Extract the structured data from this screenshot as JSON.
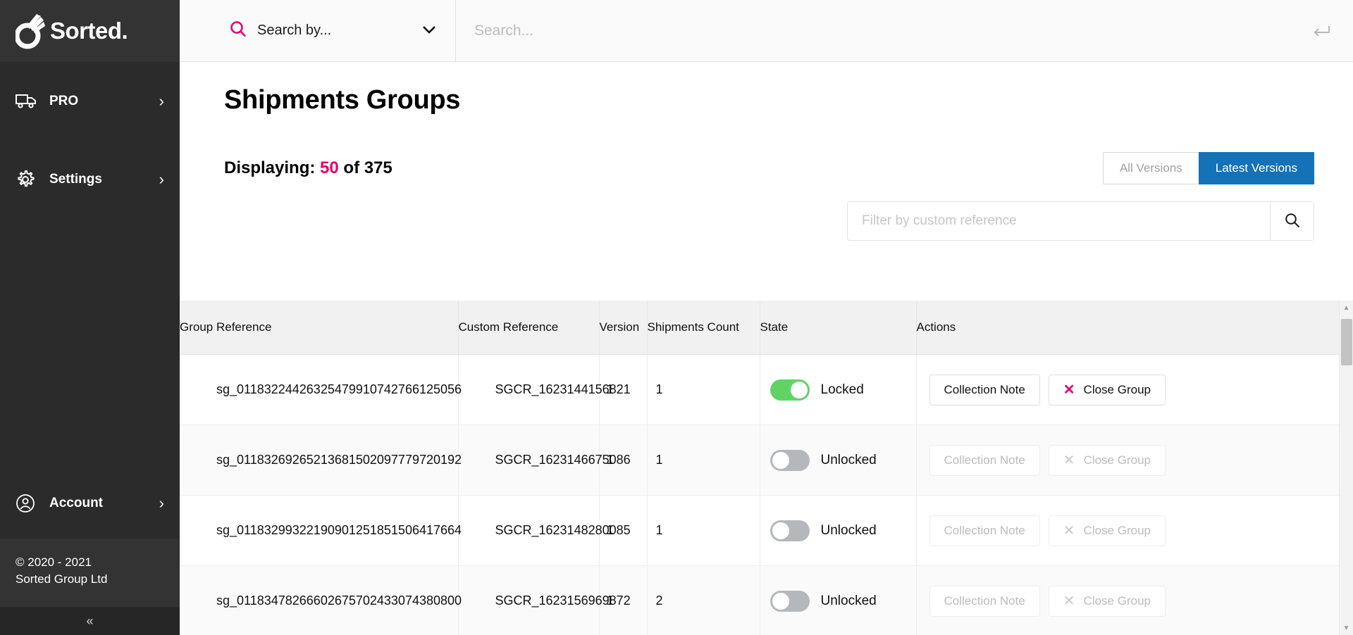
{
  "sidebar": {
    "brand": "Sorted.",
    "items": [
      {
        "label": "PRO",
        "icon": "truck-icon"
      },
      {
        "label": "Settings",
        "icon": "gear-icon"
      }
    ],
    "account": {
      "label": "Account",
      "icon": "user-circle-icon"
    },
    "copyright_line1": "© 2020 - 2021",
    "copyright_line2": "Sorted Group Ltd",
    "collapse_glyph": "«"
  },
  "topbar": {
    "search_by_label": "Search by...",
    "search_placeholder": "Search...",
    "search_value": "",
    "enter_icon": "enter-return-icon"
  },
  "page": {
    "title": "Shipments Groups",
    "displaying_label": "Displaying:",
    "displaying_count": "50",
    "displaying_of": "of 375",
    "accent_color": "#e6006e",
    "active_button_color": "#1472b8"
  },
  "version_toggle": {
    "options": [
      {
        "label": "All Versions",
        "active": false
      },
      {
        "label": "Latest Versions",
        "active": true
      }
    ]
  },
  "filter": {
    "placeholder": "Filter by custom reference",
    "value": "",
    "search_icon": "search-icon"
  },
  "table": {
    "columns": [
      "Group Reference",
      "Custom Reference",
      "Version",
      "Shipments Count",
      "State",
      "Actions"
    ],
    "action_labels": {
      "collection_note": "Collection Note",
      "close_group": "Close Group"
    },
    "rows": [
      {
        "group_reference": "sg_01183224426325479910742766125056",
        "custom_reference": "SGCR_1623144156821",
        "version": "1",
        "shipments_count": "1",
        "state_label": "Locked",
        "locked": true,
        "actions_enabled": true
      },
      {
        "group_reference": "sg_01183269265213681502097779720192",
        "custom_reference": "SGCR_1623146675086",
        "version": "1",
        "shipments_count": "1",
        "state_label": "Unlocked",
        "locked": false,
        "actions_enabled": false
      },
      {
        "group_reference": "sg_01183299322190901251851506417664",
        "custom_reference": "SGCR_1623148280085",
        "version": "1",
        "shipments_count": "1",
        "state_label": "Unlocked",
        "locked": false,
        "actions_enabled": false
      },
      {
        "group_reference": "sg_01183478266602675702433074380800",
        "custom_reference": "SGCR_1623156969872",
        "version": "1",
        "shipments_count": "2",
        "state_label": "Unlocked",
        "locked": false,
        "actions_enabled": false
      }
    ]
  },
  "scrollbar": {
    "up_glyph": "▲",
    "down_glyph": "▼"
  }
}
